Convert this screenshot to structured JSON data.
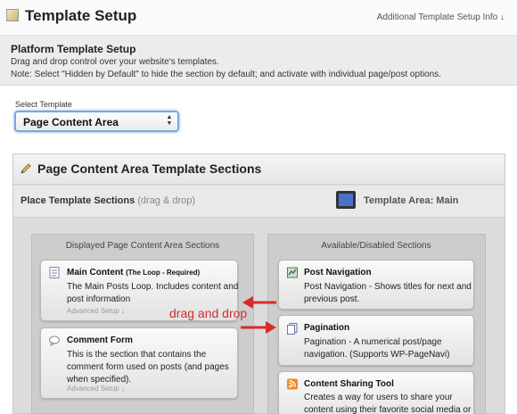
{
  "header": {
    "title": "Template Setup",
    "setup_link": "Additional Template Setup Info ↓"
  },
  "info": {
    "title": "Platform Template Setup",
    "description": "Drag and drop control over your website's templates.",
    "note": "Note: Select \"Hidden by Default\" to hide the section by default; and activate with individual page/post options."
  },
  "template_select": {
    "label": "Select Template",
    "value": "Page Content Area"
  },
  "panel": {
    "title": "Page Content Area Template Sections",
    "place_title": "Place Template Sections",
    "place_hint": "(drag & drop)",
    "area_label": "Template Area: Main"
  },
  "displayed": {
    "title": "Displayed Page Content Area Sections",
    "cards": [
      {
        "icon": "document-icon",
        "title": "Main Content",
        "title_note": "(The Loop - Required)",
        "desc": [
          "The Main Posts Loop. Includes content and",
          "post information"
        ],
        "advanced": "Advanced Setup ↓"
      },
      {
        "icon": "comment-icon",
        "title": "Comment Form",
        "desc": [
          "This is the section that contains the",
          "comment form used on posts (and pages",
          "when specified)."
        ],
        "advanced": "Advanced Setup ↓"
      }
    ]
  },
  "available": {
    "title": "Available/Disabled Sections",
    "cards": [
      {
        "icon": "navigation-icon",
        "title": "Post Navigation",
        "desc": [
          "Post Navigation - Shows titles for next and",
          "previous post."
        ]
      },
      {
        "icon": "pages-icon",
        "title": "Pagination",
        "desc": [
          "Pagination - A numerical post/page",
          "navigation. (Supports WP-PageNavi)"
        ]
      },
      {
        "icon": "rss-icon",
        "title": "Content Sharing Tool",
        "desc": [
          "Creates a way for users to share your",
          "content using their favorite social media or"
        ]
      }
    ]
  },
  "annotation": {
    "text": "drag and drop",
    "color": "#d62b2b"
  }
}
